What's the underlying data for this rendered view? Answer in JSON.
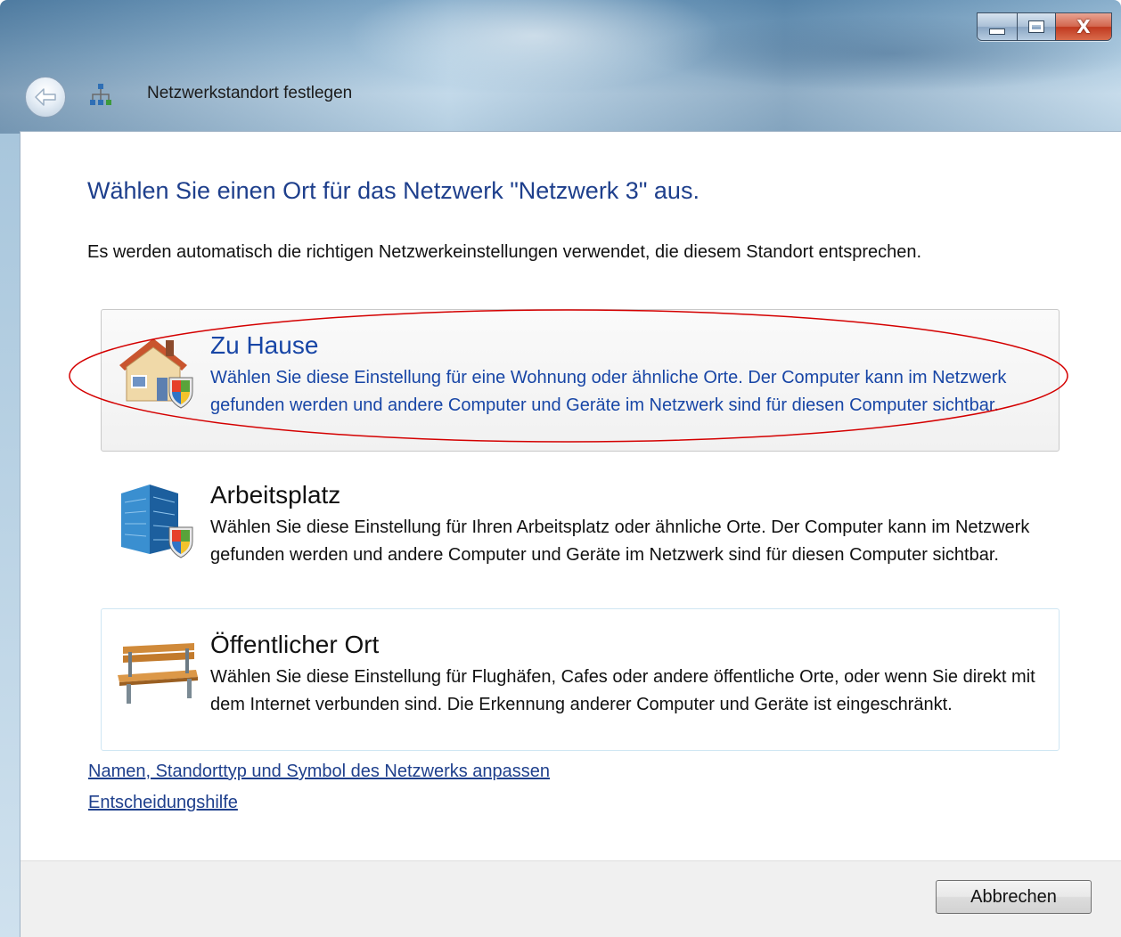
{
  "window": {
    "title": "Netzwerkstandort festlegen",
    "caption_buttons": {
      "close_glyph": "X"
    }
  },
  "main": {
    "heading": "Wählen Sie einen Ort für das Netzwerk \"Netzwerk  3\" aus.",
    "description": "Es werden automatisch die richtigen Netzwerkeinstellungen verwendet, die diesem Standort entsprechen.",
    "options": [
      {
        "icon": "house-shield-icon",
        "title": "Zu Hause",
        "description": "Wählen Sie diese Einstellung für eine Wohnung oder ähnliche Orte. Der Computer kann im Netzwerk gefunden werden und andere Computer und Geräte im Netzwerk sind für diesen Computer sichtbar.",
        "highlighted": true
      },
      {
        "icon": "office-building-shield-icon",
        "title": "Arbeitsplatz",
        "description": "Wählen Sie diese Einstellung für Ihren Arbeitsplatz oder ähnliche Orte. Der Computer kann im Netzwerk gefunden werden und andere Computer und Geräte im Netzwerk sind für diesen Computer sichtbar."
      },
      {
        "icon": "park-bench-icon",
        "title": "Öffentlicher Ort",
        "description": "Wählen Sie diese Einstellung für Flughäfen, Cafes oder andere öffentliche Orte, oder wenn Sie direkt mit dem Internet verbunden sind. Die Erkennung anderer Computer und Geräte ist eingeschränkt."
      }
    ],
    "links": {
      "customize": "Namen, Standorttyp und Symbol des Netzwerks anpassen",
      "help": "Entscheidungshilfe"
    }
  },
  "footer": {
    "cancel_label": "Abbrechen"
  },
  "colors": {
    "link_blue": "#1e3f8c",
    "highlight_blue": "#1846a6",
    "annotation_red": "#d40000",
    "close_red": "#c0391f"
  }
}
